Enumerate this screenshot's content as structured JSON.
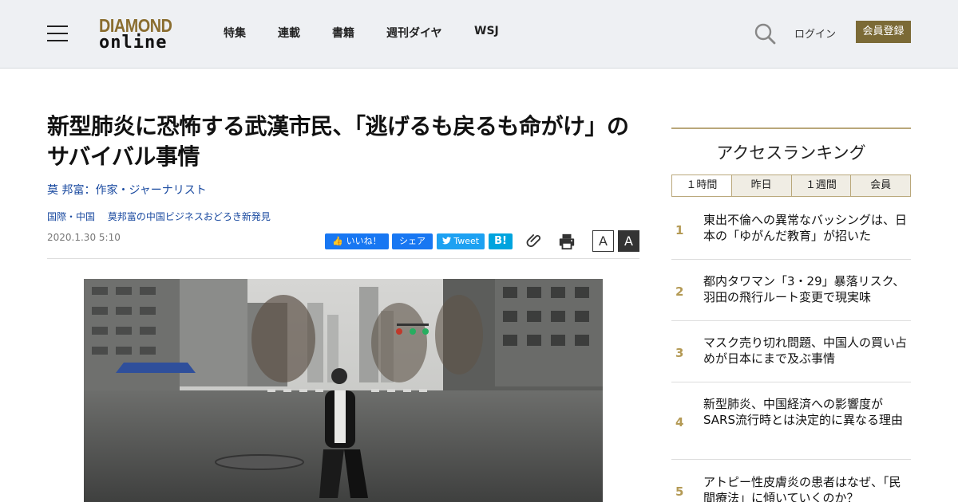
{
  "header": {
    "logo_top": "DIAMOND",
    "logo_bottom": "online",
    "nav": [
      "特集",
      "連載",
      "書籍",
      "週刊ダイヤ",
      "WSJ"
    ],
    "login": "ログイン",
    "register": "会員登録"
  },
  "article": {
    "title": "新型肺炎に恐怖する武漢市民、「逃げるも戻るも命がけ」のサバイバル事情",
    "author": "莫 邦富：作家・ジャーナリスト",
    "categories": [
      "国際・中国",
      "莫邦富の中国ビジネスおどろき新発見"
    ],
    "date": "2020.1.30 5:10",
    "share": {
      "like": "いいね！",
      "share": "シェア",
      "tweet": "Tweet",
      "hatena": "B!"
    },
    "font_small": "A",
    "font_large": "A"
  },
  "ranking": {
    "title": "アクセスランキング",
    "tabs": [
      "１時間",
      "昨日",
      "１週間",
      "会員"
    ],
    "items": [
      {
        "rank": "1",
        "text": "東出不倫への異常なバッシングは、日本の「ゆがんだ教育」が招いた"
      },
      {
        "rank": "2",
        "text": "都内タワマン「3・29」暴落リスク、羽田の飛行ルート変更で現実味"
      },
      {
        "rank": "3",
        "text": "マスク売り切れ問題、中国人の買い占めが日本にまで及ぶ事情"
      },
      {
        "rank": "4",
        "text": "新型肺炎、中国経済への影響度がSARS流行時とは決定的に異なる理由"
      },
      {
        "rank": "5",
        "text": "アトピー性皮膚炎の患者はなぜ、「民間療法」に傾いていくのか？"
      }
    ]
  },
  "colors": {
    "accent": "#7b6a36",
    "link": "#1a4aa0",
    "facebook": "#1877f2",
    "twitter": "#1da1f2",
    "hatena": "#00a4de"
  }
}
